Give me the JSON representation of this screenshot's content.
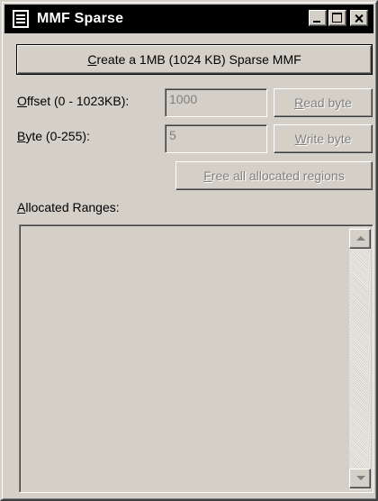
{
  "window": {
    "title": "MMF Sparse",
    "title_icon": "document-grid-icon",
    "controls": {
      "minimize_icon": "minimize-icon",
      "maximize_icon": "maximize-icon",
      "close_icon": "close-icon"
    }
  },
  "create_button": {
    "mnemonic": "C",
    "rest": "reate a 1MB (1024 KB) Sparse MMF"
  },
  "offset": {
    "label_mnemonic": "O",
    "label_rest": "ffset (0 - 1023KB):",
    "value": "1000"
  },
  "byte": {
    "label_mnemonic": "B",
    "label_rest": "yte (0-255):",
    "value": "5"
  },
  "read_button": {
    "mnemonic": "R",
    "rest": "ead byte"
  },
  "write_button": {
    "mnemonic": "W",
    "rest": "rite byte"
  },
  "free_button": {
    "mnemonic": "F",
    "rest": "ree all allocated regions"
  },
  "ranges": {
    "label_mnemonic": "A",
    "label_rest": "llocated Ranges:"
  },
  "scrollbar": {
    "up_icon": "scroll-up-arrow-icon",
    "down_icon": "scroll-down-arrow-icon"
  },
  "colors": {
    "face": "#d4d0c8",
    "titlebar": "#000000",
    "disabled_text": "#808080"
  }
}
